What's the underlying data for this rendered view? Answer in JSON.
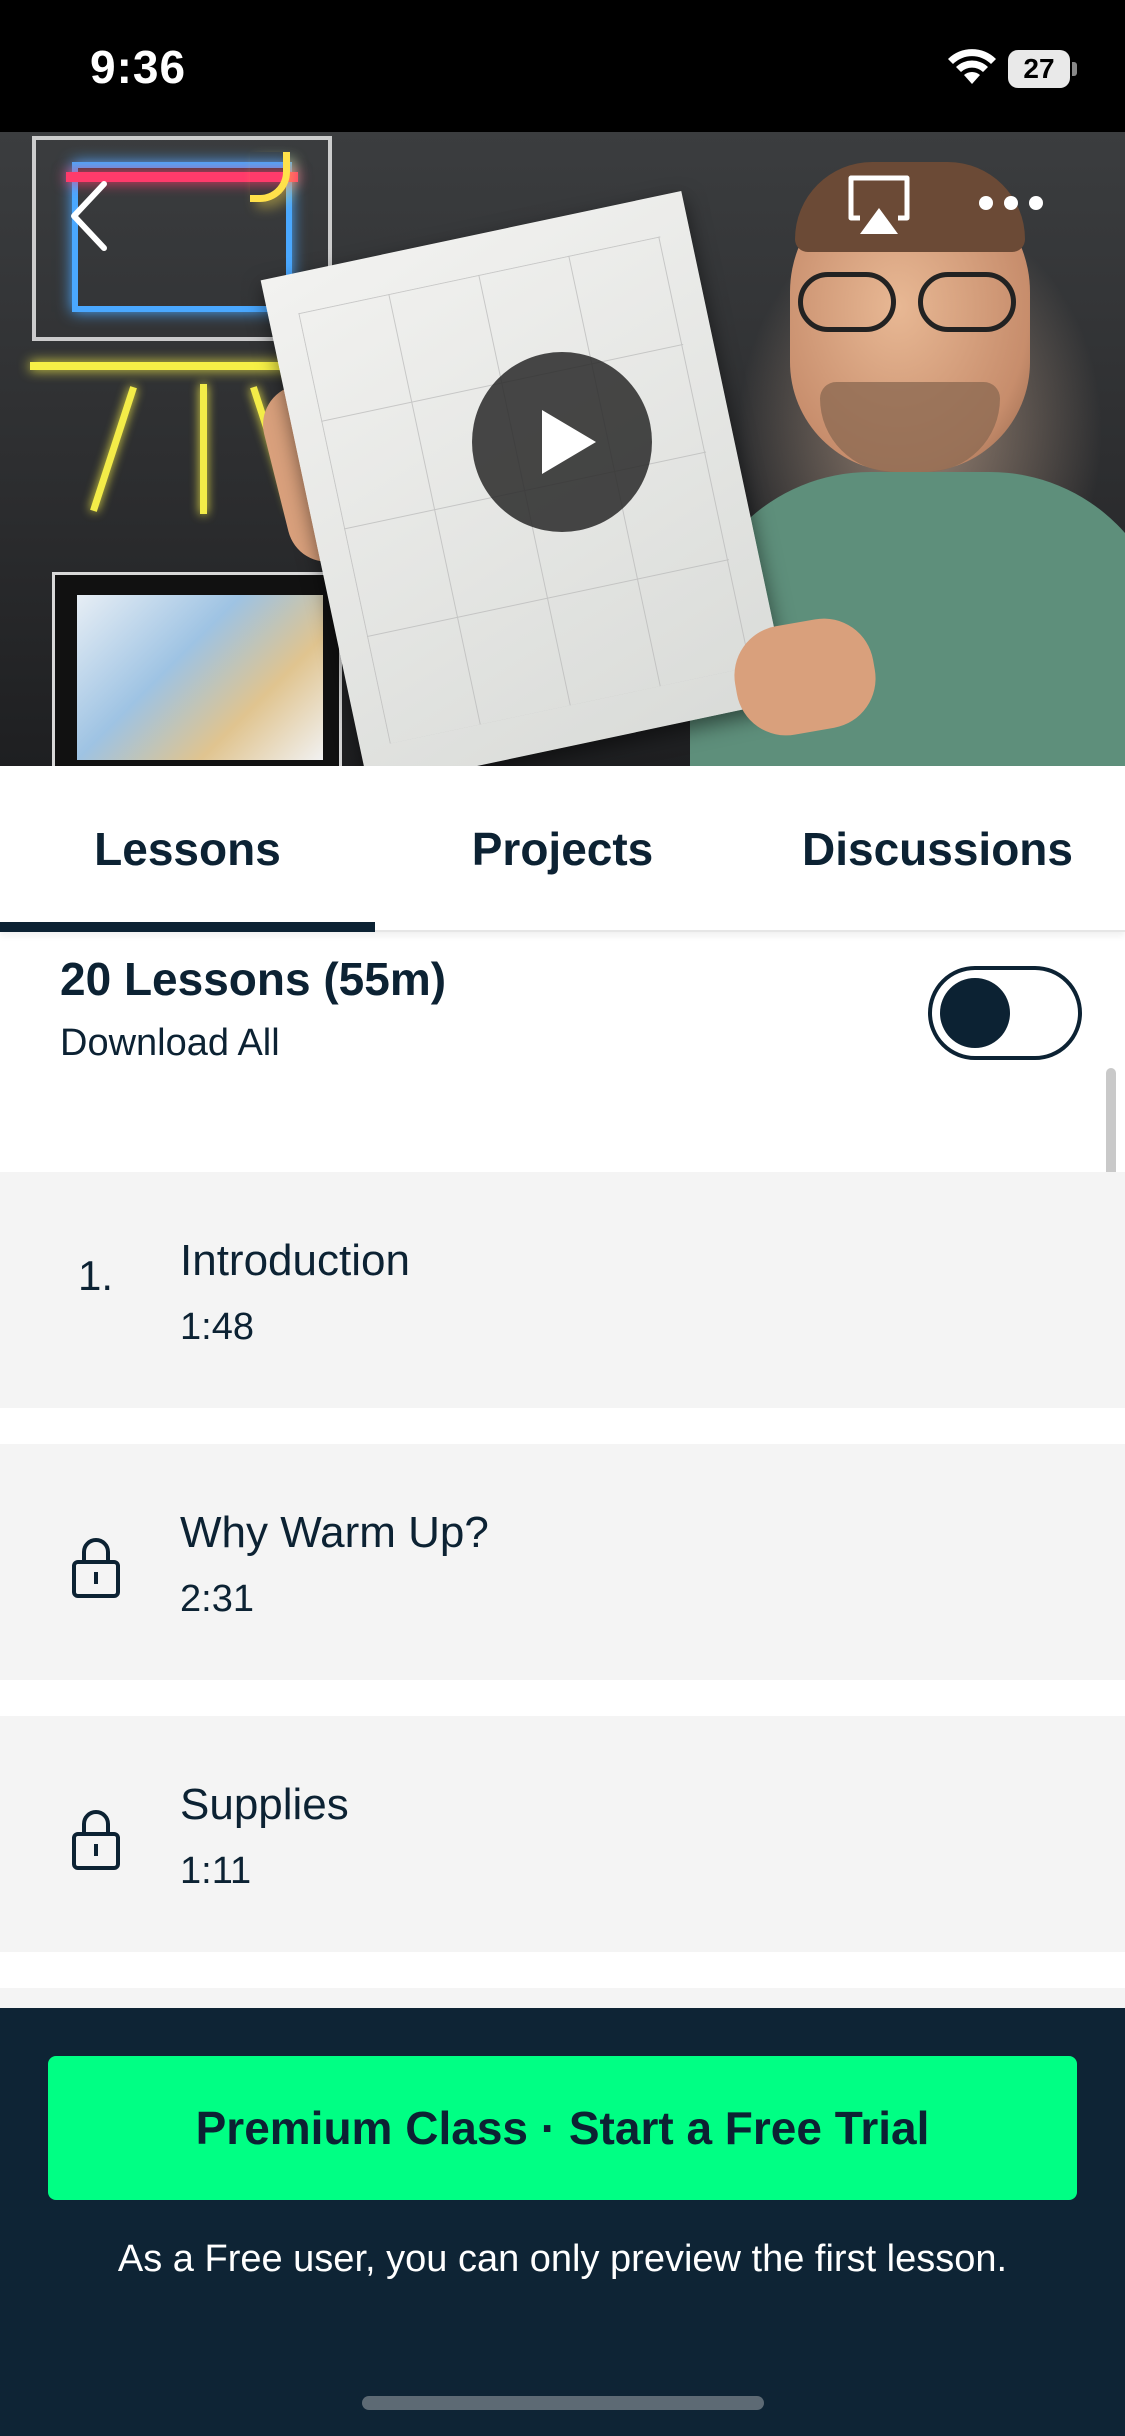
{
  "status_bar": {
    "time": "9:36",
    "battery": "27",
    "icons": [
      "wifi-icon",
      "battery-icon"
    ]
  },
  "video": {
    "icons": [
      "back-chevron-icon",
      "airplay-icon",
      "more-horizontal-icon",
      "play-icon"
    ]
  },
  "tabs": [
    {
      "label": "Lessons",
      "active": true
    },
    {
      "label": "Projects",
      "active": false
    },
    {
      "label": "Discussions",
      "active": false
    }
  ],
  "lessons": {
    "summary": "20 Lessons (55m)",
    "download_all": "Download All",
    "download_all_enabled": false,
    "items": [
      {
        "number": "1.",
        "title": "Introduction",
        "duration": "1:48",
        "locked": false
      },
      {
        "title": "Why Warm Up?",
        "duration": "2:31",
        "locked": true,
        "icon": "lock-icon"
      },
      {
        "title": "Supplies",
        "duration": "1:11",
        "locked": true,
        "icon": "lock-icon"
      }
    ]
  },
  "cta": {
    "button_label": "Premium Class · Start a Free Trial",
    "note": "As a Free user, you can only preview the first lesson."
  },
  "colors": {
    "primary_dark": "#0c2233",
    "cta_green": "#00ff84",
    "panel_dark": "#0e2435",
    "row_bg": "#f4f4f4"
  }
}
